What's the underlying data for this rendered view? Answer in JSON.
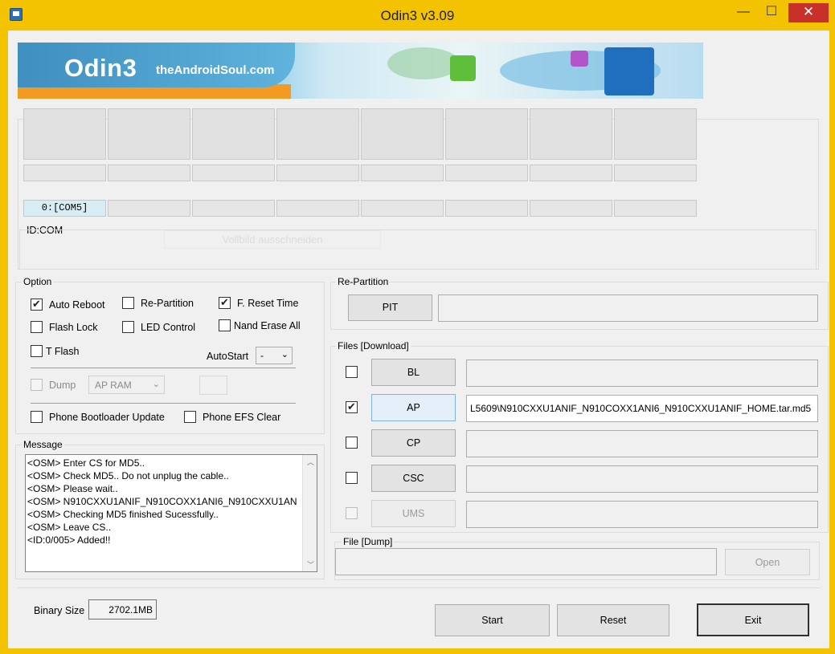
{
  "window": {
    "title": "Odin3 v3.09",
    "min": "—",
    "max": "☐",
    "close": "✕"
  },
  "banner": {
    "logo": "Odin3",
    "site": "theAndroidSoul.com"
  },
  "slots": {
    "com_label": "0:[COM5]"
  },
  "idcom": {
    "label": "ID:COM",
    "ghost_text": "Vollbild ausschneiden"
  },
  "option": {
    "title": "Option",
    "auto_reboot": "Auto Reboot",
    "re_partition": "Re-Partition",
    "f_reset_time": "F. Reset Time",
    "flash_lock": "Flash Lock",
    "led_control": "LED Control",
    "nand_erase_all": "Nand Erase All",
    "t_flash": "T Flash",
    "autostart_label": "AutoStart",
    "autostart_value": "-",
    "dump_label": "Dump",
    "dump_select": "AP RAM",
    "phone_bootloader_update": "Phone Bootloader Update",
    "phone_efs_clear": "Phone EFS Clear"
  },
  "repartition": {
    "title": "Re-Partition",
    "pit_button": "PIT"
  },
  "files": {
    "title": "Files [Download]",
    "rows": [
      {
        "button": "BL",
        "path": "",
        "checked": false,
        "enabled": true
      },
      {
        "button": "AP",
        "path": "L5609\\N910CXXU1ANIF_N910COXX1ANI6_N910CXXU1ANIF_HOME.tar.md5",
        "checked": true,
        "enabled": true
      },
      {
        "button": "CP",
        "path": "",
        "checked": false,
        "enabled": true
      },
      {
        "button": "CSC",
        "path": "",
        "checked": false,
        "enabled": true
      },
      {
        "button": "UMS",
        "path": "",
        "checked": false,
        "enabled": false
      }
    ]
  },
  "message": {
    "title": "Message",
    "lines": [
      "<OSM> Enter CS for MD5..",
      "<OSM> Check MD5.. Do not unplug the cable..",
      "<OSM> Please wait..",
      "<OSM> N910CXXU1ANIF_N910COXX1ANI6_N910CXXU1AN",
      "<OSM> Checking MD5 finished Sucessfully..",
      "<OSM> Leave CS..",
      "<ID:0/005> Added!!"
    ]
  },
  "dump": {
    "title": "File [Dump]",
    "open_button": "Open"
  },
  "bottom": {
    "binary_size_label": "Binary Size",
    "binary_size_value": "2702.1MB",
    "start": "Start",
    "reset": "Reset",
    "exit": "Exit"
  },
  "colors": {
    "titlebar": "#f3c200",
    "close": "#c7312a",
    "banner_orange": "#f29a22"
  }
}
